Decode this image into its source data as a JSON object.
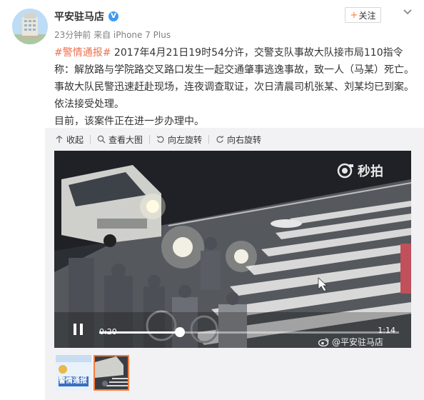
{
  "header": {
    "username": "平安驻马店",
    "verified_icon": "verified-v-icon",
    "meta": "23分钟前 来自 iPhone 7 Plus",
    "follow_label": "关注"
  },
  "post": {
    "hashtag": "#警情通报#",
    "body": " 2017年4月21日19时54分许，交警支队事故大队接市局110指令称：解放路与学院路交叉路口发生一起交通肇事逃逸事故，致一人（马某）死亡。事故大队民警迅速赶赴现场，连夜调查取证，次日清晨司机张某、刘某均已到案。依法接受处理。",
    "body2": "目前，该案件正在进一步办理中。"
  },
  "toolbar": {
    "collapse": "收起",
    "view_large": "查看大图",
    "rotate_left": "向左旋转",
    "rotate_right": "向右旋转"
  },
  "video": {
    "watermark": "秒拍",
    "current_time": "0:20",
    "total_time": "1:14",
    "progress": 0.27,
    "source_mark": "@平安驻马店"
  },
  "thumbnails": {
    "thumb1_caption": "警情通报"
  },
  "colors": {
    "accent": "#fa7d3c",
    "hashtag": "#eb7350",
    "verified": "#3d9bf4"
  }
}
